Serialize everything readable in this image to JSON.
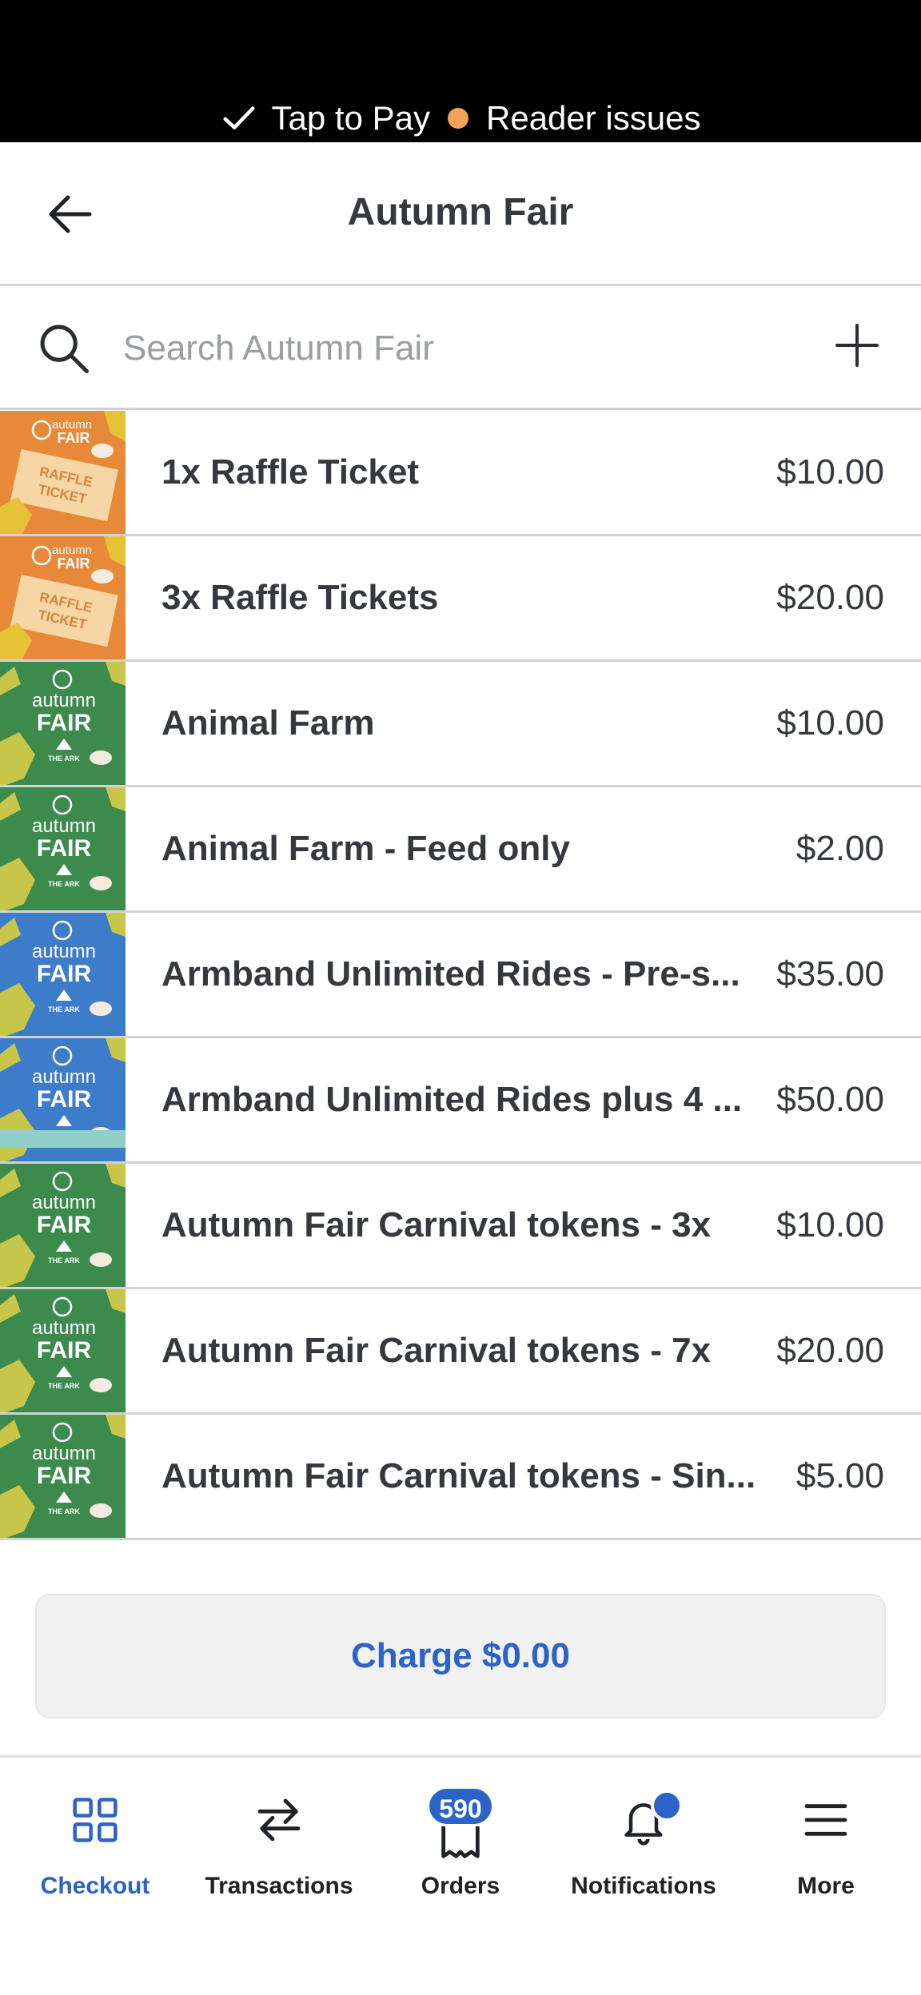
{
  "status": {
    "tap_to_pay": "Tap to Pay",
    "reader_issues": "Reader issues",
    "reader_dot_color": "#f0a35a"
  },
  "header": {
    "title": "Autumn Fair",
    "back_icon": "arrow-left-icon"
  },
  "search": {
    "placeholder": "Search Autumn Fair",
    "value": "",
    "search_icon": "search-icon",
    "add_icon": "plus-icon"
  },
  "products": [
    {
      "name": "1x Raffle Ticket",
      "price": "$10.00",
      "thumb": "raffle"
    },
    {
      "name": "3x Raffle Tickets",
      "price": "$20.00",
      "thumb": "raffle"
    },
    {
      "name": "Animal Farm",
      "price": "$10.00",
      "thumb": "green"
    },
    {
      "name": "Animal Farm - Feed only",
      "price": "$2.00",
      "thumb": "green"
    },
    {
      "name": "Armband Unlimited Rides - Pre-s...",
      "price": "$35.00",
      "thumb": "blue"
    },
    {
      "name": "Armband Unlimited Rides plus 4 ...",
      "price": "$50.00",
      "thumb": "blue"
    },
    {
      "name": "Autumn Fair Carnival tokens - 3x",
      "price": "$10.00",
      "thumb": "green"
    },
    {
      "name": "Autumn Fair Carnival tokens - 7x",
      "price": "$20.00",
      "thumb": "green"
    },
    {
      "name": "Autumn Fair Carnival tokens - Sin...",
      "price": "$5.00",
      "thumb": "green"
    }
  ],
  "thumbnail_text": {
    "logo_line1": "autumn",
    "logo_line2": "FAIR",
    "raffle_line1": "RAFFLE",
    "raffle_line2": "TICKET",
    "sponsor": "THE ARK"
  },
  "charge": {
    "label": "Charge $0.00"
  },
  "tabs": [
    {
      "id": "checkout",
      "label": "Checkout",
      "icon": "grid-icon",
      "active": true
    },
    {
      "id": "transactions",
      "label": "Transactions",
      "icon": "arrows-swap-icon",
      "active": false
    },
    {
      "id": "orders",
      "label": "Orders",
      "icon": "receipt-icon",
      "badge": "590",
      "active": false
    },
    {
      "id": "notifications",
      "label": "Notifications",
      "icon": "bell-icon",
      "active": false
    },
    {
      "id": "more",
      "label": "More",
      "icon": "menu-icon",
      "active": false
    }
  ],
  "colors": {
    "accent": "#2b63c9",
    "thumb_orange": "#e8893a",
    "thumb_green": "#3c8a4c",
    "thumb_blue": "#3d7cc9"
  }
}
